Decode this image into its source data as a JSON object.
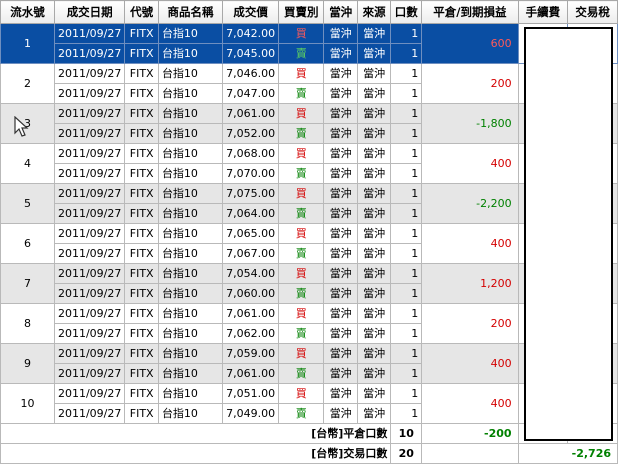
{
  "columns": [
    "流水號",
    "成交日期",
    "代號",
    "商品名稱",
    "成交價",
    "買賣別",
    "當沖",
    "來源",
    "口數",
    "平倉/到期損益",
    "手續費",
    "交易稅"
  ],
  "groups": [
    {
      "serial": "1",
      "pnl": "600",
      "pnl_sign": "pos",
      "selected": true,
      "shade": false,
      "rows": [
        {
          "date": "2011/09/27",
          "code": "FITX",
          "name": "台指10",
          "price": "7,042.00",
          "side": "買",
          "side_type": "buy",
          "daytrade": "當沖",
          "source": "當沖",
          "qty": "1"
        },
        {
          "date": "2011/09/27",
          "code": "FITX",
          "name": "台指10",
          "price": "7,045.00",
          "side": "賣",
          "side_type": "sell",
          "daytrade": "當沖",
          "source": "當沖",
          "qty": "1"
        }
      ]
    },
    {
      "serial": "2",
      "pnl": "200",
      "pnl_sign": "pos",
      "selected": false,
      "shade": false,
      "rows": [
        {
          "date": "2011/09/27",
          "code": "FITX",
          "name": "台指10",
          "price": "7,046.00",
          "side": "買",
          "side_type": "buy",
          "daytrade": "當沖",
          "source": "當沖",
          "qty": "1"
        },
        {
          "date": "2011/09/27",
          "code": "FITX",
          "name": "台指10",
          "price": "7,047.00",
          "side": "賣",
          "side_type": "sell",
          "daytrade": "當沖",
          "source": "當沖",
          "qty": "1"
        }
      ]
    },
    {
      "serial": "3",
      "pnl": "-1,800",
      "pnl_sign": "neg",
      "selected": false,
      "shade": true,
      "rows": [
        {
          "date": "2011/09/27",
          "code": "FITX",
          "name": "台指10",
          "price": "7,061.00",
          "side": "買",
          "side_type": "buy",
          "daytrade": "當沖",
          "source": "當沖",
          "qty": "1"
        },
        {
          "date": "2011/09/27",
          "code": "FITX",
          "name": "台指10",
          "price": "7,052.00",
          "side": "賣",
          "side_type": "sell",
          "daytrade": "當沖",
          "source": "當沖",
          "qty": "1"
        }
      ]
    },
    {
      "serial": "4",
      "pnl": "400",
      "pnl_sign": "pos",
      "selected": false,
      "shade": false,
      "rows": [
        {
          "date": "2011/09/27",
          "code": "FITX",
          "name": "台指10",
          "price": "7,068.00",
          "side": "買",
          "side_type": "buy",
          "daytrade": "當沖",
          "source": "當沖",
          "qty": "1"
        },
        {
          "date": "2011/09/27",
          "code": "FITX",
          "name": "台指10",
          "price": "7,070.00",
          "side": "賣",
          "side_type": "sell",
          "daytrade": "當沖",
          "source": "當沖",
          "qty": "1"
        }
      ]
    },
    {
      "serial": "5",
      "pnl": "-2,200",
      "pnl_sign": "neg",
      "selected": false,
      "shade": true,
      "rows": [
        {
          "date": "2011/09/27",
          "code": "FITX",
          "name": "台指10",
          "price": "7,075.00",
          "side": "買",
          "side_type": "buy",
          "daytrade": "當沖",
          "source": "當沖",
          "qty": "1"
        },
        {
          "date": "2011/09/27",
          "code": "FITX",
          "name": "台指10",
          "price": "7,064.00",
          "side": "賣",
          "side_type": "sell",
          "daytrade": "當沖",
          "source": "當沖",
          "qty": "1"
        }
      ]
    },
    {
      "serial": "6",
      "pnl": "400",
      "pnl_sign": "pos",
      "selected": false,
      "shade": false,
      "rows": [
        {
          "date": "2011/09/27",
          "code": "FITX",
          "name": "台指10",
          "price": "7,065.00",
          "side": "買",
          "side_type": "buy",
          "daytrade": "當沖",
          "source": "當沖",
          "qty": "1"
        },
        {
          "date": "2011/09/27",
          "code": "FITX",
          "name": "台指10",
          "price": "7,067.00",
          "side": "賣",
          "side_type": "sell",
          "daytrade": "當沖",
          "source": "當沖",
          "qty": "1"
        }
      ]
    },
    {
      "serial": "7",
      "pnl": "1,200",
      "pnl_sign": "pos",
      "selected": false,
      "shade": true,
      "rows": [
        {
          "date": "2011/09/27",
          "code": "FITX",
          "name": "台指10",
          "price": "7,054.00",
          "side": "買",
          "side_type": "buy",
          "daytrade": "當沖",
          "source": "當沖",
          "qty": "1"
        },
        {
          "date": "2011/09/27",
          "code": "FITX",
          "name": "台指10",
          "price": "7,060.00",
          "side": "賣",
          "side_type": "sell",
          "daytrade": "當沖",
          "source": "當沖",
          "qty": "1"
        }
      ]
    },
    {
      "serial": "8",
      "pnl": "200",
      "pnl_sign": "pos",
      "selected": false,
      "shade": false,
      "rows": [
        {
          "date": "2011/09/27",
          "code": "FITX",
          "name": "台指10",
          "price": "7,061.00",
          "side": "買",
          "side_type": "buy",
          "daytrade": "當沖",
          "source": "當沖",
          "qty": "1"
        },
        {
          "date": "2011/09/27",
          "code": "FITX",
          "name": "台指10",
          "price": "7,062.00",
          "side": "賣",
          "side_type": "sell",
          "daytrade": "當沖",
          "source": "當沖",
          "qty": "1"
        }
      ]
    },
    {
      "serial": "9",
      "pnl": "400",
      "pnl_sign": "pos",
      "selected": false,
      "shade": true,
      "rows": [
        {
          "date": "2011/09/27",
          "code": "FITX",
          "name": "台指10",
          "price": "7,059.00",
          "side": "買",
          "side_type": "buy",
          "daytrade": "當沖",
          "source": "當沖",
          "qty": "1"
        },
        {
          "date": "2011/09/27",
          "code": "FITX",
          "name": "台指10",
          "price": "7,061.00",
          "side": "賣",
          "side_type": "sell",
          "daytrade": "當沖",
          "source": "當沖",
          "qty": "1"
        }
      ]
    },
    {
      "serial": "10",
      "pnl": "400",
      "pnl_sign": "pos",
      "selected": false,
      "shade": false,
      "rows": [
        {
          "date": "2011/09/27",
          "code": "FITX",
          "name": "台指10",
          "price": "7,051.00",
          "side": "買",
          "side_type": "buy",
          "daytrade": "當沖",
          "source": "當沖",
          "qty": "1"
        },
        {
          "date": "2011/09/27",
          "code": "FITX",
          "name": "台指10",
          "price": "7,049.00",
          "side": "賣",
          "side_type": "sell",
          "daytrade": "當沖",
          "source": "當沖",
          "qty": "1"
        }
      ]
    }
  ],
  "summary": {
    "close_label": "[台幣]平倉口數",
    "close_qty": "10",
    "close_pnl": "-200",
    "trade_label": "[台幣]交易口數",
    "trade_qty": "20",
    "trade_total": "-2,726"
  },
  "colors": {
    "selected_row": "#0a4ea3",
    "buy": "#d40000",
    "sell": "#008000",
    "shade_row": "#e6e6e6"
  },
  "cursor_icon": "mouse-pointer-icon"
}
